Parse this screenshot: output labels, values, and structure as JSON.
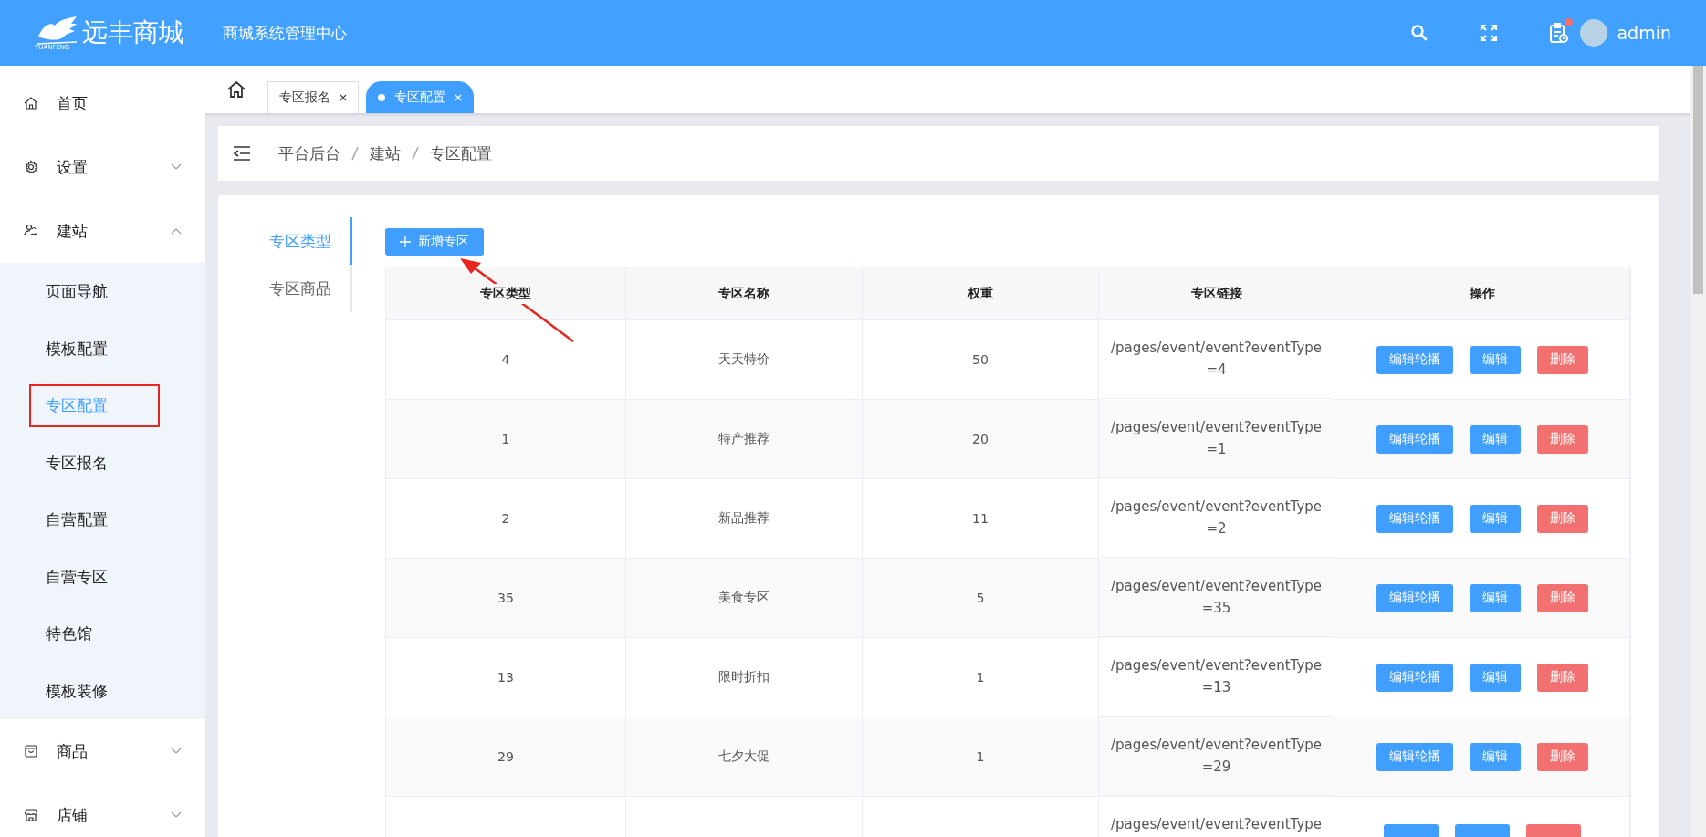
{
  "header": {
    "logo_text": "远丰商城",
    "logo_subtext": "YUANFENG",
    "title": "商城系统管理中心",
    "user": "admin",
    "notification_dot": true
  },
  "sidebar": {
    "items": [
      {
        "label": "首页"
      },
      {
        "label": "设置",
        "expanded": false
      },
      {
        "label": "建站",
        "expanded": true,
        "children": [
          {
            "label": "页面导航",
            "selected": false,
            "highlighted": false
          },
          {
            "label": "模板配置",
            "selected": false,
            "highlighted": false
          },
          {
            "label": "专区配置",
            "selected": true,
            "highlighted": true
          },
          {
            "label": "专区报名",
            "selected": false,
            "highlighted": false
          },
          {
            "label": "自营配置",
            "selected": false,
            "highlighted": false
          },
          {
            "label": "自营专区",
            "selected": false,
            "highlighted": false
          },
          {
            "label": "特色馆",
            "selected": false,
            "highlighted": false
          },
          {
            "label": "模板装修",
            "selected": false,
            "highlighted": false
          }
        ]
      },
      {
        "label": "商品",
        "expanded": false
      },
      {
        "label": "店铺",
        "expanded": false
      }
    ]
  },
  "page_tabs": [
    {
      "label": "专区报名",
      "selected": false
    },
    {
      "label": "专区配置",
      "selected": true
    }
  ],
  "breadcrumb": [
    "平台后台",
    "建站",
    "专区配置"
  ],
  "side_tabs": [
    {
      "label": "专区类型",
      "selected": true
    },
    {
      "label": "专区商品",
      "selected": false
    }
  ],
  "add_button": "新增专区",
  "arrow_annotation": true,
  "table": {
    "columns": [
      "专区类型",
      "专区名称",
      "权重",
      "专区链接",
      "操作"
    ],
    "rows": [
      {
        "type": "4",
        "name": "天天特价",
        "weight": "50",
        "link": [
          "/pages/event/event?eventType",
          "=4"
        ],
        "actions": [
          {
            "kind": "primary",
            "label": "编辑轮播"
          },
          {
            "kind": "primary",
            "label": "编辑"
          },
          {
            "kind": "danger",
            "label": "删除"
          }
        ]
      },
      {
        "type": "1",
        "name": "特产推荐",
        "weight": "20",
        "link": [
          "/pages/event/event?eventType",
          "=1"
        ],
        "actions": [
          {
            "kind": "primary",
            "label": "编辑轮播"
          },
          {
            "kind": "primary",
            "label": "编辑"
          },
          {
            "kind": "danger",
            "label": "删除"
          }
        ]
      },
      {
        "type": "2",
        "name": "新品推荐",
        "weight": "11",
        "link": [
          "/pages/event/event?eventType",
          "=2"
        ],
        "actions": [
          {
            "kind": "primary",
            "label": "编辑轮播"
          },
          {
            "kind": "primary",
            "label": "编辑"
          },
          {
            "kind": "danger",
            "label": "删除"
          }
        ]
      },
      {
        "type": "35",
        "name": "美食专区",
        "weight": "5",
        "link": [
          "/pages/event/event?eventType",
          "=35"
        ],
        "actions": [
          {
            "kind": "primary",
            "label": "编辑轮播"
          },
          {
            "kind": "primary",
            "label": "编辑"
          },
          {
            "kind": "danger",
            "label": "删除"
          }
        ]
      },
      {
        "type": "13",
        "name": "限时折扣",
        "weight": "1",
        "link": [
          "/pages/event/event?eventType",
          "=13"
        ],
        "actions": [
          {
            "kind": "primary",
            "label": "编辑轮播"
          },
          {
            "kind": "primary",
            "label": "编辑"
          },
          {
            "kind": "danger",
            "label": "删除"
          }
        ]
      },
      {
        "type": "29",
        "name": "七夕大促",
        "weight": "1",
        "link": [
          "/pages/event/event?eventType",
          "=29"
        ],
        "actions": [
          {
            "kind": "primary",
            "label": "编辑轮播"
          },
          {
            "kind": "primary",
            "label": "编辑"
          },
          {
            "kind": "danger",
            "label": "删除"
          }
        ]
      },
      {
        "link": [
          "/pages/event/event?eventType"
        ],
        "actions": [
          {
            "kind": "primary"
          },
          {
            "kind": "primary"
          },
          {
            "kind": "danger"
          }
        ]
      }
    ]
  }
}
